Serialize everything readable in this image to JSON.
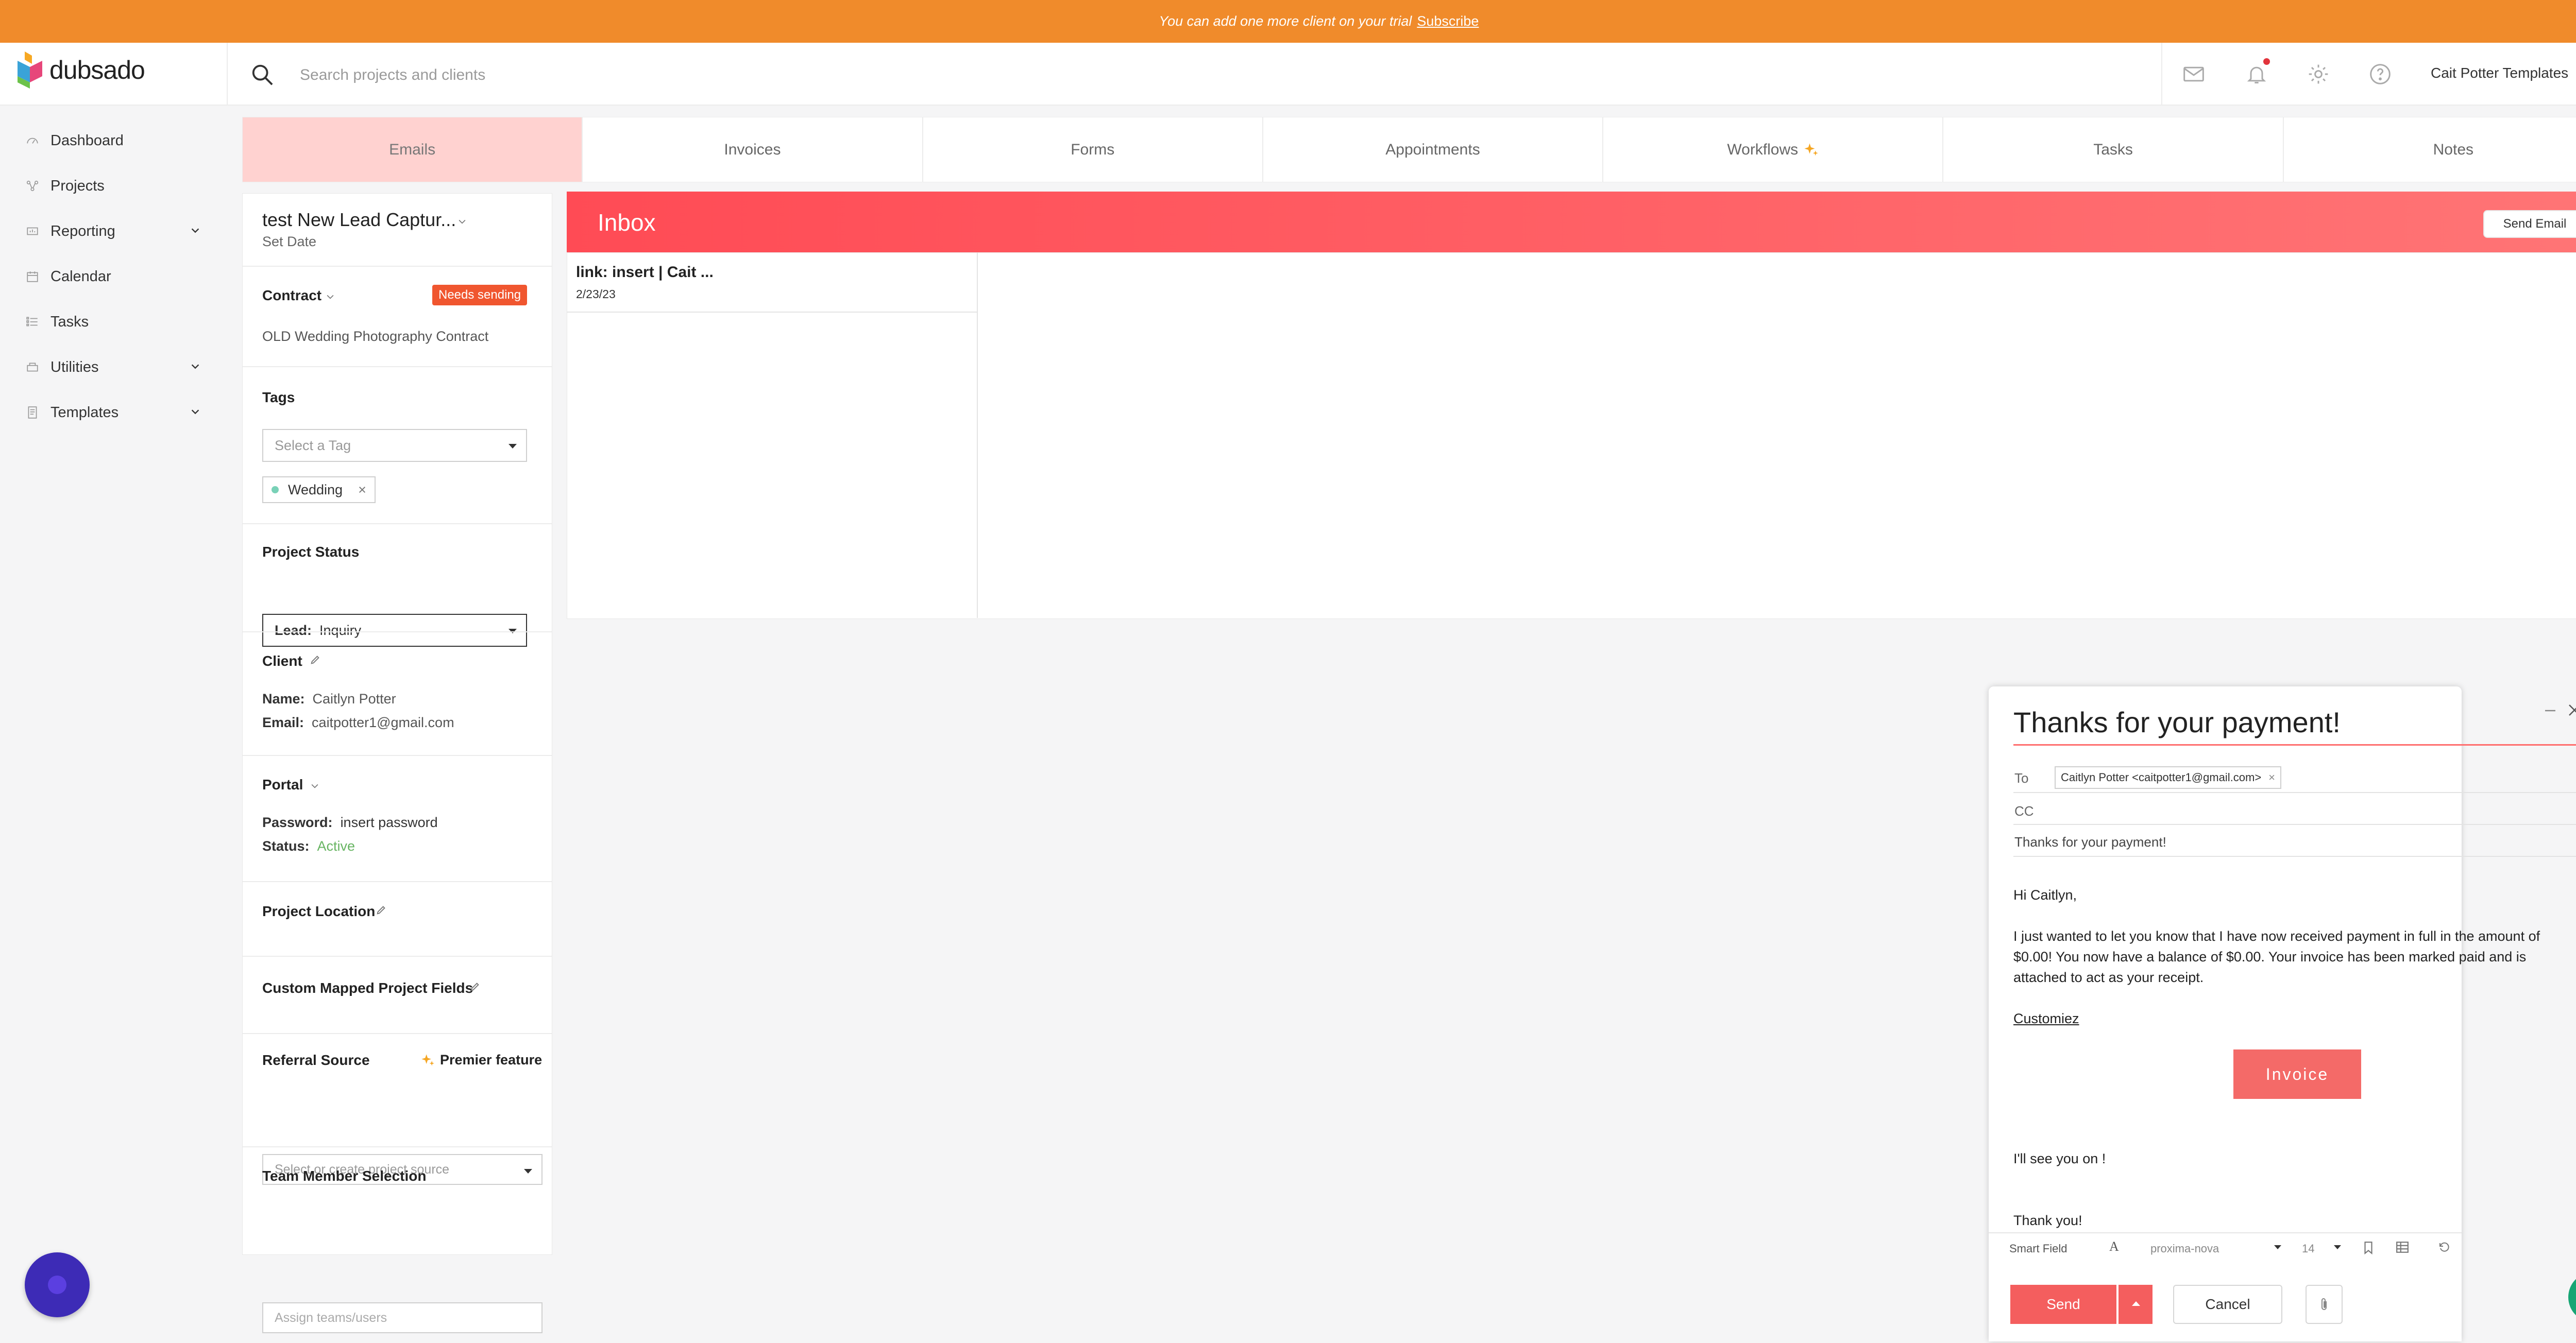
{
  "banner": {
    "text": "You can add one more client on your trial",
    "link": "Subscribe"
  },
  "header": {
    "brand": "dubsado",
    "search_placeholder": "Search projects and clients",
    "user": "Cait Potter Templates"
  },
  "sidebar": {
    "items": [
      {
        "label": "Dashboard",
        "icon": "dashboard-icon"
      },
      {
        "label": "Projects",
        "icon": "projects-icon"
      },
      {
        "label": "Reporting",
        "icon": "reporting-icon"
      },
      {
        "label": "Calendar",
        "icon": "calendar-icon"
      },
      {
        "label": "Tasks",
        "icon": "tasks-icon"
      },
      {
        "label": "Utilities",
        "icon": "utilities-icon"
      },
      {
        "label": "Templates",
        "icon": "templates-icon"
      }
    ]
  },
  "tabs": [
    "Emails",
    "Invoices",
    "Forms",
    "Appointments",
    "Workflows",
    "Tasks",
    "Notes"
  ],
  "project": {
    "title": "test New Lead Captur...",
    "set_date": "Set Date",
    "contract_label": "Contract",
    "contract_badge": "Needs sending",
    "contract_name": "OLD Wedding Photography Contract",
    "tags_label": "Tags",
    "tags_placeholder": "Select a Tag",
    "tag": "Wedding",
    "status_label": "Project Status",
    "status_prefix": "Lead:",
    "status_value": "Inquiry",
    "client_label": "Client",
    "name_key": "Name:",
    "name_val": "Caitlyn Potter",
    "email_key": "Email:",
    "email_val": "caitpotter1@gmail.com",
    "portal_label": "Portal",
    "password_key": "Password:",
    "password_val": "insert password",
    "status_key": "Status:",
    "status_val": "Active",
    "location_label": "Project Location",
    "custom_label": "Custom Mapped Project Fields",
    "referral_label": "Referral Source",
    "premier": "Premier feature",
    "referral_placeholder": "Select or create project source",
    "team_label": "Team Member Selection",
    "team_placeholder": "Assign teams/users"
  },
  "inbox": {
    "title": "Inbox",
    "send_email": "Send Email",
    "message": {
      "subject": "link: insert | Cait ...",
      "date": "2/23/23"
    }
  },
  "composer": {
    "subject": "Thanks for your payment!",
    "to_label": "To",
    "recipient": "Caitlyn Potter <caitpotter1@gmail.com>",
    "cc_label": "CC",
    "subject_line": "Thanks for your payment!",
    "greeting": "Hi Caitlyn,",
    "paragraph": "I just wanted to let you know that I have now received payment in full in the amount of $0.00! You now have a balance of $0.00. Your invoice has been marked paid and is attached to act as your receipt.",
    "customize": "Customiez",
    "invoice_button": "Invoice",
    "see_you": "I'll see you on !",
    "thanks": "Thank you!",
    "toolbar": {
      "smart_field": "Smart Field",
      "font": "proxima-nova",
      "size": "14"
    },
    "send": "Send",
    "cancel": "Cancel"
  },
  "colors": {
    "banner": "#f08b2b",
    "accent": "#ff5a5f",
    "active_tab": "#ffd2d0",
    "badge": "#f0562f"
  }
}
